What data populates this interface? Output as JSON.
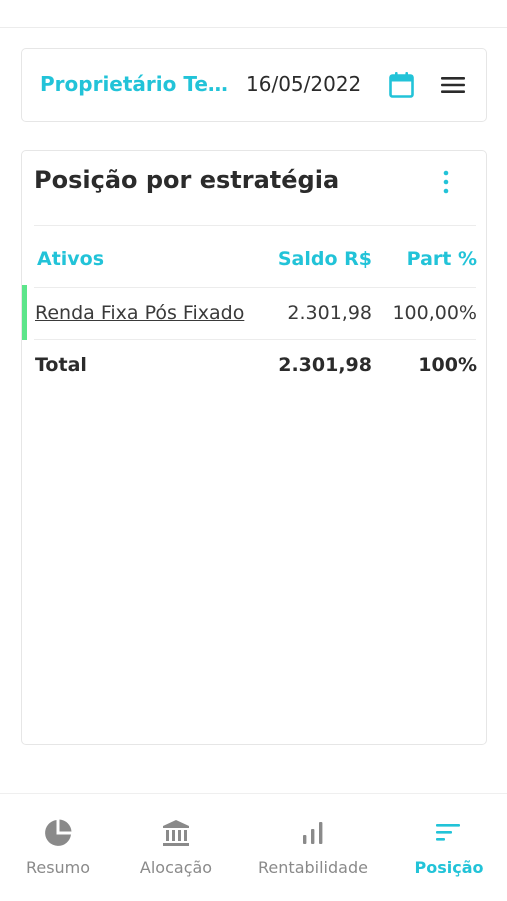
{
  "header": {
    "owner_name": "Proprietário Teste",
    "date": "16/05/2022",
    "calendar_icon": "calendar-icon",
    "menu_icon": "hamburger-menu-icon"
  },
  "strategy_card": {
    "title": "Posição por estratégia",
    "columns": [
      "Ativos",
      "Saldo R$",
      "Part %"
    ],
    "rows": [
      {
        "asset": "Renda Fixa Pós Fixado",
        "saldo": "2.301,98",
        "part": "100,00%",
        "marker_color": "#5ce58a"
      }
    ],
    "total": {
      "label": "Total",
      "saldo": "2.301,98",
      "part": "100%"
    }
  },
  "bottom_nav": {
    "items": [
      {
        "label": "Resumo",
        "icon": "pie-chart-icon",
        "active": false
      },
      {
        "label": "Alocação",
        "icon": "bank-icon",
        "active": false
      },
      {
        "label": "Rentabilidade",
        "icon": "bar-chart-icon",
        "active": false
      },
      {
        "label": "Posição",
        "icon": "sort-lines-icon",
        "active": true
      }
    ]
  },
  "colors": {
    "accent": "#22c3d8",
    "text": "#2b2b2b",
    "muted": "#8a8a8a",
    "marker": "#5ce58a"
  }
}
